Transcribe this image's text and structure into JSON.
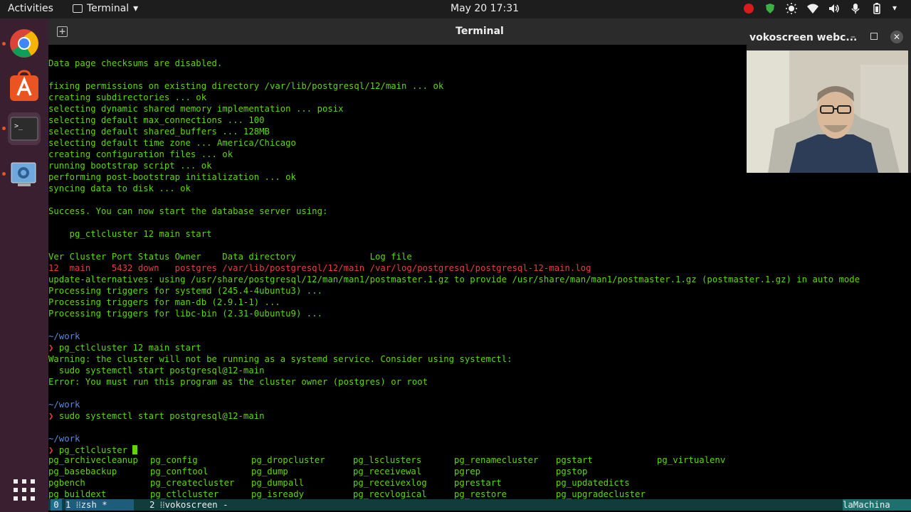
{
  "topbar": {
    "activities": "Activities",
    "app_name": "Terminal",
    "clock": "May 20  17:31"
  },
  "window": {
    "title": "Terminal"
  },
  "terminal_lines": [
    {
      "segments": [
        {
          "text": "Data page checksums are disabled.",
          "color": "green"
        }
      ]
    },
    {
      "segments": [
        {
          "text": "",
          "color": "green"
        }
      ]
    },
    {
      "segments": [
        {
          "text": "fixing permissions on existing directory /var/lib/postgresql/12/main ... ok",
          "color": "green"
        }
      ]
    },
    {
      "segments": [
        {
          "text": "creating subdirectories ... ok",
          "color": "green"
        }
      ]
    },
    {
      "segments": [
        {
          "text": "selecting dynamic shared memory implementation ... posix",
          "color": "green"
        }
      ]
    },
    {
      "segments": [
        {
          "text": "selecting default max_connections ... 100",
          "color": "green"
        }
      ]
    },
    {
      "segments": [
        {
          "text": "selecting default shared_buffers ... 128MB",
          "color": "green"
        }
      ]
    },
    {
      "segments": [
        {
          "text": "selecting default time zone ... America/Chicago",
          "color": "green"
        }
      ]
    },
    {
      "segments": [
        {
          "text": "creating configuration files ... ok",
          "color": "green"
        }
      ]
    },
    {
      "segments": [
        {
          "text": "running bootstrap script ... ok",
          "color": "green"
        }
      ]
    },
    {
      "segments": [
        {
          "text": "performing post-bootstrap initialization ... ok",
          "color": "green"
        }
      ]
    },
    {
      "segments": [
        {
          "text": "syncing data to disk ... ok",
          "color": "green"
        }
      ]
    },
    {
      "segments": [
        {
          "text": "",
          "color": "green"
        }
      ]
    },
    {
      "segments": [
        {
          "text": "Success. You can now start the database server using:",
          "color": "green"
        }
      ]
    },
    {
      "segments": [
        {
          "text": "",
          "color": "green"
        }
      ]
    },
    {
      "segments": [
        {
          "text": "    pg_ctlcluster 12 main start",
          "color": "green"
        }
      ]
    },
    {
      "segments": [
        {
          "text": "",
          "color": "green"
        }
      ]
    },
    {
      "segments": [
        {
          "text": "Ver Cluster Port Status Owner    Data directory              Log file",
          "color": "green"
        }
      ]
    },
    {
      "segments": [
        {
          "text": "12  main    5432 down   postgres /var/lib/postgresql/12/main /var/log/postgresql/postgresql-12-main.log",
          "color": "red"
        }
      ]
    },
    {
      "segments": [
        {
          "text": "update-alternatives: using /usr/share/postgresql/12/man/man1/postmaster.1.gz to provide /usr/share/man/man1/postmaster.1.gz (postmaster.1.gz) in auto mode",
          "color": "green"
        }
      ]
    },
    {
      "segments": [
        {
          "text": "Processing triggers for systemd (245.4-4ubuntu3) ...",
          "color": "green"
        }
      ]
    },
    {
      "segments": [
        {
          "text": "Processing triggers for man-db (2.9.1-1) ...",
          "color": "green"
        }
      ]
    },
    {
      "segments": [
        {
          "text": "Processing triggers for libc-bin (2.31-0ubuntu9) ...",
          "color": "green"
        }
      ]
    },
    {
      "segments": [
        {
          "text": "",
          "color": "green"
        }
      ]
    },
    {
      "segments": [
        {
          "text": "~/work",
          "color": "blue"
        }
      ]
    },
    {
      "segments": [
        {
          "text": "❯ ",
          "color": "red"
        },
        {
          "text": "pg_ctlcluster 12 main start",
          "color": "green"
        }
      ]
    },
    {
      "segments": [
        {
          "text": "Warning: the cluster will not be running as a systemd service. Consider using systemctl:",
          "color": "green"
        }
      ]
    },
    {
      "segments": [
        {
          "text": "  sudo systemctl start postgresql@12-main",
          "color": "green"
        }
      ]
    },
    {
      "segments": [
        {
          "text": "Error: You must run this program as the cluster owner (postgres) or root",
          "color": "green"
        }
      ]
    },
    {
      "segments": [
        {
          "text": "",
          "color": "green"
        }
      ]
    },
    {
      "segments": [
        {
          "text": "~/work",
          "color": "blue"
        }
      ]
    },
    {
      "segments": [
        {
          "text": "❯ ",
          "color": "red"
        },
        {
          "text": "sudo systemctl start postgresql@12-main",
          "color": "green"
        }
      ]
    },
    {
      "segments": [
        {
          "text": "",
          "color": "green"
        }
      ]
    },
    {
      "segments": [
        {
          "text": "~/work",
          "color": "blue"
        }
      ]
    },
    {
      "segments": [
        {
          "text": "❯ ",
          "color": "red"
        },
        {
          "text": "pg_ctlcluster ",
          "color": "green"
        }
      ],
      "cursor": true
    }
  ],
  "completions": [
    [
      "pg_archivecleanup",
      "pg_config",
      "pg_dropcluster",
      "pg_lsclusters",
      "pg_renamecluster",
      "pgstart",
      "pg_virtualenv"
    ],
    [
      "pg_basebackup",
      "pg_conftool",
      "pg_dump",
      "pg_receivewal",
      "pgrep",
      "pgstop",
      ""
    ],
    [
      "pgbench",
      "pg_createcluster",
      "pg_dumpall",
      "pg_receivexlog",
      "pgrestart",
      "pg_updatedicts",
      ""
    ],
    [
      "pg_buildext",
      "pg_ctlcluster",
      "pg_isready",
      "pg_recvlogical",
      "pg_restore",
      "pg_upgradecluster",
      ""
    ]
  ],
  "statusline": {
    "session": "0",
    "win1": "1 ⁞⁞zsh *",
    "win2": "2 ⁞⁞vokoscreen -",
    "host": "laMachina"
  },
  "webcam": {
    "title": "vokoscreen webc...",
    "minimize": "–",
    "close": "✕"
  },
  "dock": {
    "apps": [
      "chrome-icon",
      "software-center-icon",
      "terminal-icon",
      "settings-tool-icon"
    ],
    "show_apps": "apps-grid-icon"
  },
  "colors": {
    "green": "#5fd700",
    "red": "#e04040",
    "blue": "#5f87d7",
    "accent": "#e95420"
  }
}
